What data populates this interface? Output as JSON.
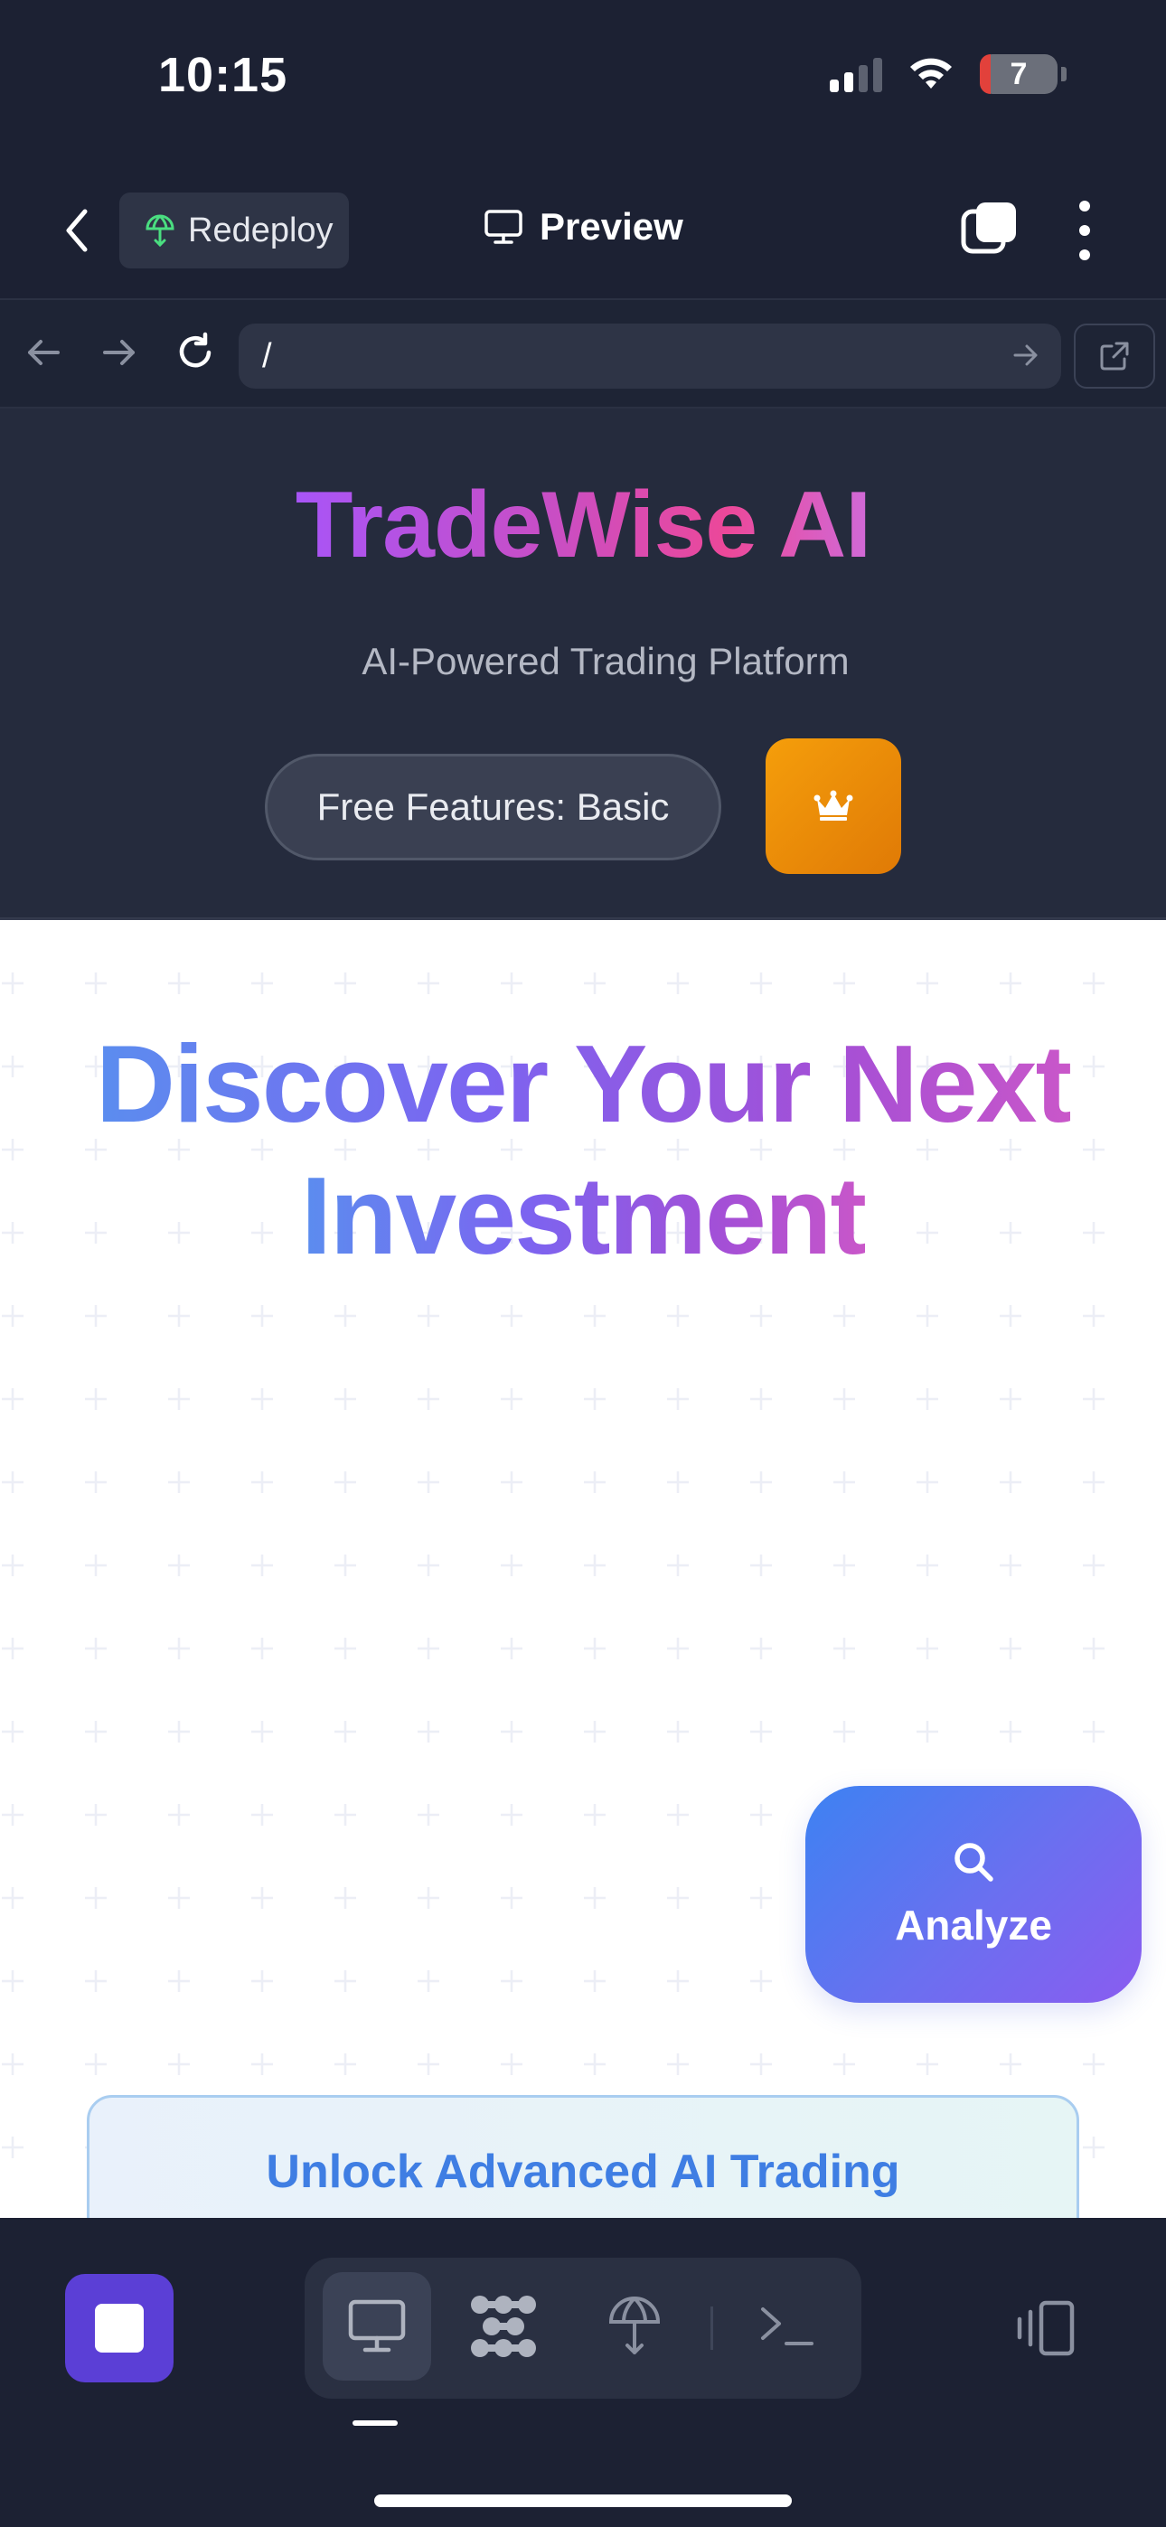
{
  "status_bar": {
    "time": "10:15",
    "battery_level": "7"
  },
  "app_bar": {
    "redeploy_label": "Redeploy",
    "preview_label": "Preview"
  },
  "url_bar": {
    "url": "/"
  },
  "site": {
    "brand": "TradeWise AI",
    "tagline": "AI-Powered Trading Platform",
    "features_pill": "Free Features: Basic",
    "crown_icon": "crown-icon"
  },
  "hero": {
    "line1": "Discover Your Next",
    "line2": "Investment"
  },
  "analyze": {
    "label": "Analyze"
  },
  "unlock_card": {
    "title": "Unlock Advanced AI Trading"
  },
  "bottom_toolbar": {
    "segments": [
      "desktop-icon",
      "workflow-icon",
      "deploy-icon",
      "terminal-icon"
    ],
    "active_segment": "desktop-icon"
  },
  "colors": {
    "dark_bg": "#1c2133",
    "accent_purple": "#5b3fd6",
    "brand_gradient_start": "#a855f7",
    "brand_gradient_end": "#ec4899",
    "analyze_blue": "#3d82f2",
    "crown_orange": "#f59e0b"
  }
}
